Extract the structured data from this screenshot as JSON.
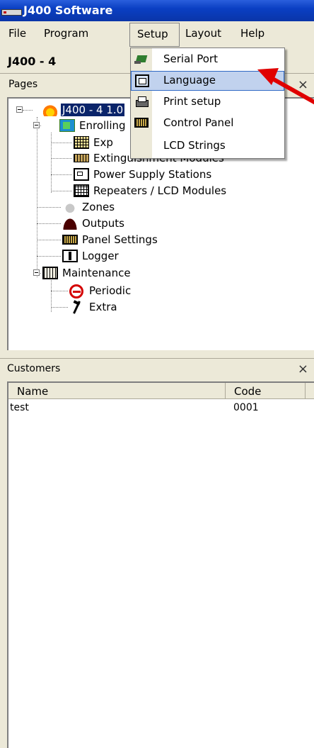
{
  "window": {
    "title": "J400 Software"
  },
  "menubar": {
    "items": [
      "File",
      "Program",
      "Setup",
      "Layout",
      "Help"
    ],
    "active": "Setup"
  },
  "toolbar": {
    "device_label": "J400 - 4"
  },
  "pages_pane": {
    "title": "Pages",
    "close": "×",
    "tree": {
      "root": "J400 - 4 1.0",
      "enrolling": "Enrolling",
      "expansion": "Exp",
      "extinguishment": "Extinguishment Modules",
      "power_supply": "Power Supply Stations",
      "repeaters": "Repeaters / LCD Modules",
      "zones": "Zones",
      "outputs": "Outputs",
      "panel_settings": "Panel Settings",
      "logger": "Logger",
      "maintenance": "Maintenance",
      "periodic": "Periodic",
      "extra": "Extra"
    }
  },
  "setup_menu": {
    "items": [
      {
        "label": "Serial Port",
        "icon": "serial-port-icon"
      },
      {
        "label": "Language",
        "icon": "language-icon",
        "highlighted": true
      },
      {
        "label": "Print setup",
        "icon": "printer-icon"
      },
      {
        "label": "Control Panel",
        "icon": "control-panel-icon"
      },
      {
        "label": "LCD Strings",
        "icon": ""
      }
    ]
  },
  "customers_pane": {
    "title": "Customers",
    "close": "×",
    "columns": [
      "Name",
      "Code"
    ],
    "rows": [
      {
        "name": "test",
        "code": "0001"
      }
    ]
  },
  "colors": {
    "titlebar": "#0a3fc3",
    "highlight": "#c1d2ee",
    "selection": "#0a246a",
    "arrow": "#e00000"
  }
}
